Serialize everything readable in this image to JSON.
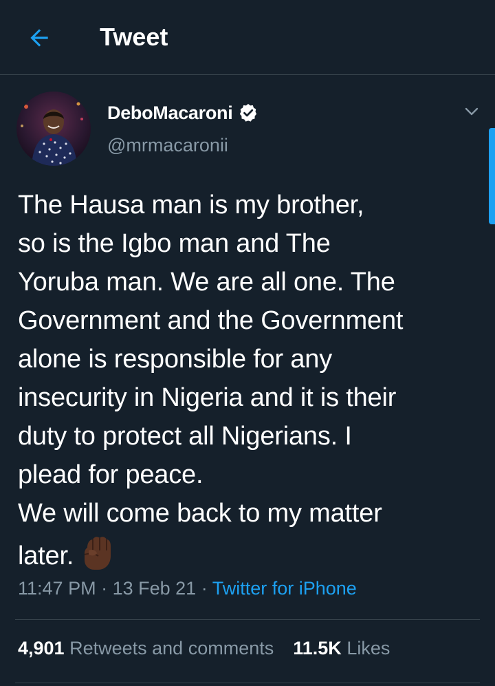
{
  "header": {
    "title": "Tweet",
    "back_icon": "arrow-left-icon"
  },
  "tweet": {
    "display_name": "DeboMacaroni",
    "verified": true,
    "handle": "@mrmacaronii",
    "text": "The Hausa man is my brother,\nso is the Igbo man and The\nYoruba man. We are all one. The\nGovernment and the Government\nalone is responsible for any\ninsecurity in Nigeria and it is their\nduty to protect all Nigerians. I\nplead for peace.\nWe will come back to my matter\nlater.",
    "emoji": "raised-fist-icon",
    "time": "11:47 PM",
    "sep1": "·",
    "date": "13 Feb 21",
    "sep2": "·",
    "source": "Twitter for iPhone"
  },
  "stats": {
    "retweets_count": "4,901",
    "retweets_label": "Retweets and comments",
    "likes_count": "11.5K",
    "likes_label": "Likes"
  },
  "colors": {
    "background": "#15202b",
    "accent": "#1da1f2",
    "secondary_text": "#8899a6",
    "divider": "#38444d"
  }
}
